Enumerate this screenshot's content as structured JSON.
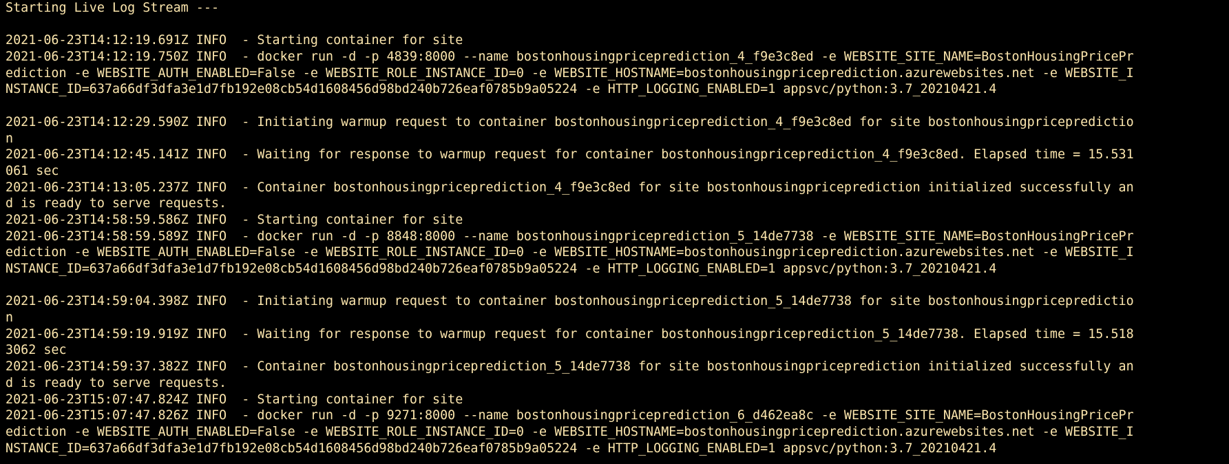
{
  "terminal": {
    "text_color": "#fce6ad",
    "background": "#000000",
    "lines": [
      "Starting Live Log Stream ---",
      "",
      "2021-06-23T14:12:19.691Z INFO  - Starting container for site",
      "2021-06-23T14:12:19.750Z INFO  - docker run -d -p 4839:8000 --name bostonhousingpriceprediction_4_f9e3c8ed -e WEBSITE_SITE_NAME=BostonHousingPricePr",
      "ediction -e WEBSITE_AUTH_ENABLED=False -e WEBSITE_ROLE_INSTANCE_ID=0 -e WEBSITE_HOSTNAME=bostonhousingpriceprediction.azurewebsites.net -e WEBSITE_I",
      "NSTANCE_ID=637a66df3dfa3e1d7fb192e08cb54d1608456d98bd240b726eaf0785b9a05224 -e HTTP_LOGGING_ENABLED=1 appsvc/python:3.7_20210421.4",
      "",
      "2021-06-23T14:12:29.590Z INFO  - Initiating warmup request to container bostonhousingpriceprediction_4_f9e3c8ed for site bostonhousingpricepredictio",
      "n",
      "2021-06-23T14:12:45.141Z INFO  - Waiting for response to warmup request for container bostonhousingpriceprediction_4_f9e3c8ed. Elapsed time = 15.531",
      "061 sec",
      "2021-06-23T14:13:05.237Z INFO  - Container bostonhousingpriceprediction_4_f9e3c8ed for site bostonhousingpriceprediction initialized successfully an",
      "d is ready to serve requests.",
      "2021-06-23T14:58:59.586Z INFO  - Starting container for site",
      "2021-06-23T14:58:59.589Z INFO  - docker run -d -p 8848:8000 --name bostonhousingpriceprediction_5_14de7738 -e WEBSITE_SITE_NAME=BostonHousingPricePr",
      "ediction -e WEBSITE_AUTH_ENABLED=False -e WEBSITE_ROLE_INSTANCE_ID=0 -e WEBSITE_HOSTNAME=bostonhousingpriceprediction.azurewebsites.net -e WEBSITE_I",
      "NSTANCE_ID=637a66df3dfa3e1d7fb192e08cb54d1608456d98bd240b726eaf0785b9a05224 -e HTTP_LOGGING_ENABLED=1 appsvc/python:3.7_20210421.4",
      "",
      "2021-06-23T14:59:04.398Z INFO  - Initiating warmup request to container bostonhousingpriceprediction_5_14de7738 for site bostonhousingpricepredictio",
      "n",
      "2021-06-23T14:59:19.919Z INFO  - Waiting for response to warmup request for container bostonhousingpriceprediction_5_14de7738. Elapsed time = 15.518",
      "3062 sec",
      "2021-06-23T14:59:37.382Z INFO  - Container bostonhousingpriceprediction_5_14de7738 for site bostonhousingpriceprediction initialized successfully an",
      "d is ready to serve requests.",
      "2021-06-23T15:07:47.824Z INFO  - Starting container for site",
      "2021-06-23T15:07:47.826Z INFO  - docker run -d -p 9271:8000 --name bostonhousingpriceprediction_6_d462ea8c -e WEBSITE_SITE_NAME=BostonHousingPricePr",
      "ediction -e WEBSITE_AUTH_ENABLED=False -e WEBSITE_ROLE_INSTANCE_ID=0 -e WEBSITE_HOSTNAME=bostonhousingpriceprediction.azurewebsites.net -e WEBSITE_I",
      "NSTANCE_ID=637a66df3dfa3e1d7fb192e08cb54d1608456d98bd240b726eaf0785b9a05224 -e HTTP_LOGGING_ENABLED=1 appsvc/python:3.7_20210421.4"
    ]
  }
}
